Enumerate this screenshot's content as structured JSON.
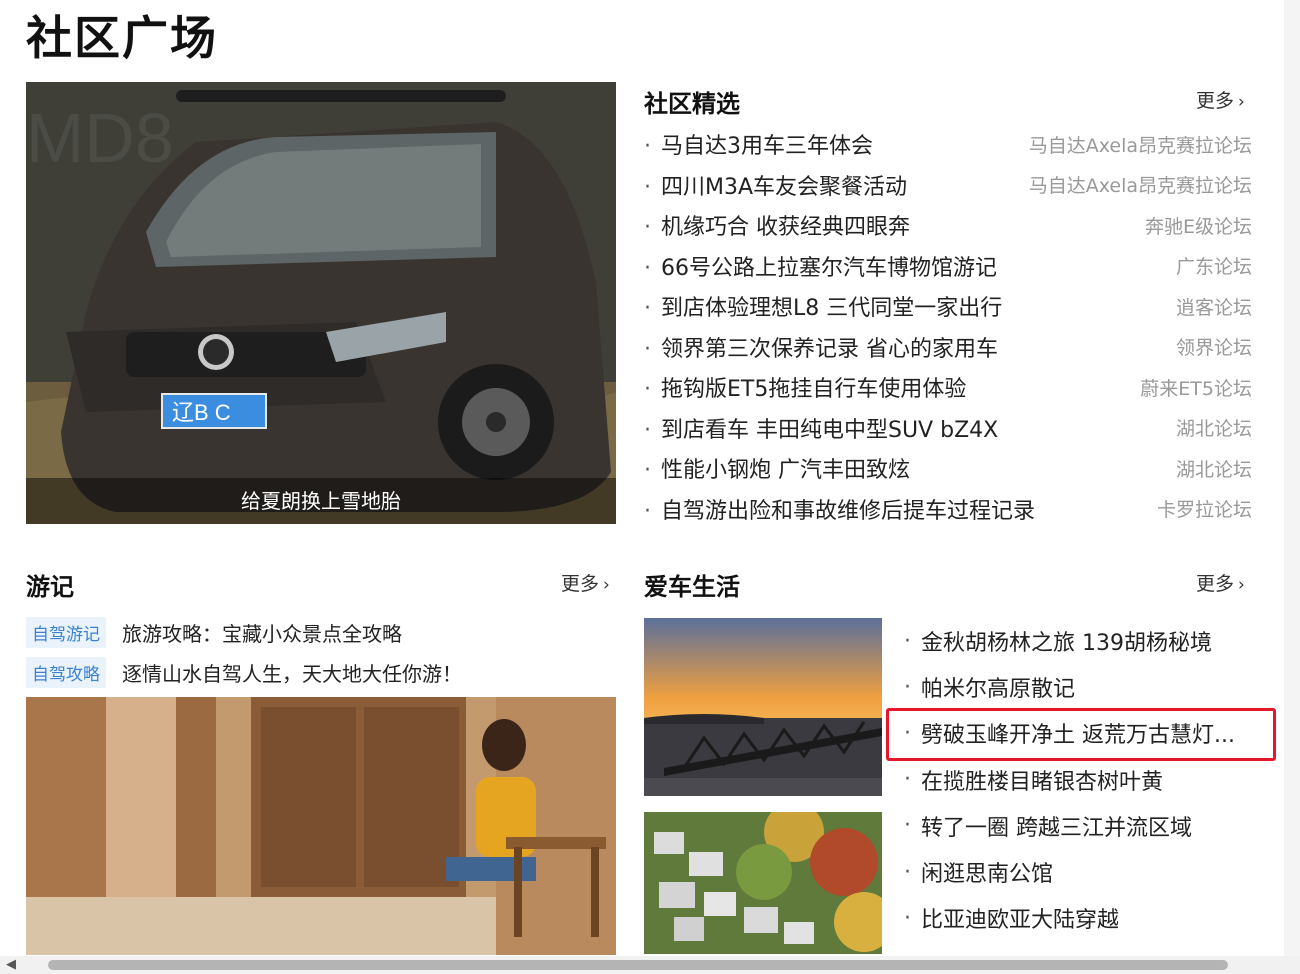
{
  "page": {
    "title": "社区广场"
  },
  "hero": {
    "caption": "给夏朗换上雪地胎",
    "plate_text": "辽B C"
  },
  "picks": {
    "title": "社区精选",
    "more_label": "更多",
    "items": [
      {
        "title": "马自达3用车三年体会",
        "forum": "马自达Axela昂克赛拉论坛"
      },
      {
        "title": "四川M3A车友会聚餐活动",
        "forum": "马自达Axela昂克赛拉论坛"
      },
      {
        "title": "机缘巧合 收获经典四眼奔",
        "forum": "奔驰E级论坛"
      },
      {
        "title": "66号公路上拉塞尔汽车博物馆游记",
        "forum": "广东论坛"
      },
      {
        "title": "到店体验理想L8 三代同堂一家出行",
        "forum": "逍客论坛"
      },
      {
        "title": "领界第三次保养记录 省心的家用车",
        "forum": "领界论坛"
      },
      {
        "title": "拖钩版ET5拖挂自行车使用体验",
        "forum": "蔚来ET5论坛"
      },
      {
        "title": "到店看车 丰田纯电中型SUV bZ4X",
        "forum": "湖北论坛"
      },
      {
        "title": "性能小钢炮 广汽丰田致炫",
        "forum": "湖北论坛"
      },
      {
        "title": "自驾游出险和事故维修后提车过程记录",
        "forum": "卡罗拉论坛"
      }
    ]
  },
  "travel": {
    "title": "游记",
    "more_label": "更多",
    "items": [
      {
        "tag": "自驾游记",
        "title": "旅游攻略：宝藏小众景点全攻略"
      },
      {
        "tag": "自驾攻略",
        "title": "逐情山水自驾人生，天大地大任你游！"
      }
    ]
  },
  "life": {
    "title": "爱车生活",
    "more_label": "更多",
    "items": [
      "金秋胡杨林之旅 139胡杨秘境",
      "帕米尔高原散记",
      "劈破玉峰开净土 返荒万古慧灯...",
      "在揽胜楼目睹银杏树叶黄",
      "转了一圈 跨越三江并流区域",
      "闲逛思南公馆",
      "比亚迪欧亚大陆穿越"
    ]
  },
  "colors": {
    "highlight": "#e3182d",
    "tag_text": "#3a82d0",
    "tag_bg": "#eaf3fc"
  }
}
